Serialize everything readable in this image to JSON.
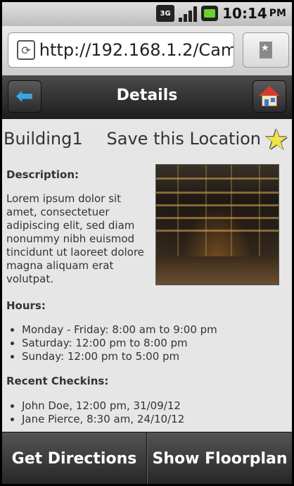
{
  "status_bar": {
    "network": "3G",
    "time": "10:14",
    "ampm": "PM",
    "icons": [
      "3g-icon",
      "signal-icon",
      "battery-icon"
    ]
  },
  "browser": {
    "url": "http://192.168.1.2/Cam..."
  },
  "header": {
    "title": "Details"
  },
  "building": {
    "name": "Building1",
    "save_label": "Save this Location"
  },
  "description": {
    "heading": "Description:",
    "text": "Lorem ipsum dolor sit amet, consectetuer adipiscing elit, sed diam nonummy nibh euismod tincidunt ut laoreet dolore magna aliquam erat volutpat."
  },
  "hours": {
    "heading": "Hours:",
    "items": [
      "Monday - Friday: 8:00 am to 9:00 pm",
      "Saturday: 12:00 pm to 8:00 pm",
      "Sunday: 12:00 pm to 5:00 pm"
    ]
  },
  "checkins": {
    "heading": "Recent Checkins:",
    "items": [
      "John Doe, 12:00 pm, 31/09/12",
      "Jane Pierce, 8:30 am, 24/10/12"
    ]
  },
  "actions": {
    "directions": "Get Directions",
    "floorplan": "Show Floorplan"
  },
  "colors": {
    "header_bg": "#2a2a2a",
    "back_arrow": "#39a6e4",
    "star": "#f1e24a"
  }
}
